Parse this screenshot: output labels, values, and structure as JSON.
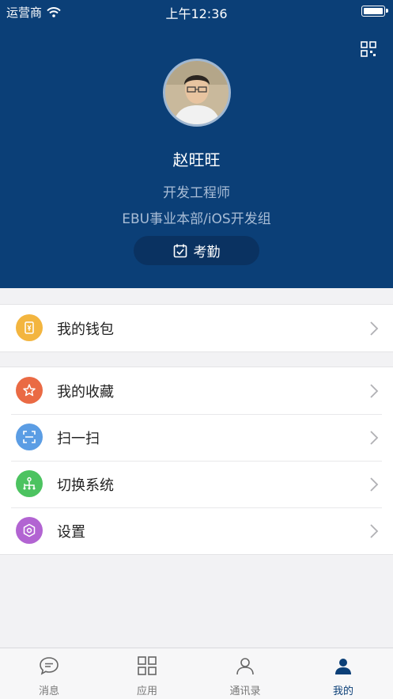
{
  "status_bar": {
    "carrier": "运营商",
    "time": "上午12:36"
  },
  "profile": {
    "name": "赵旺旺",
    "title": "开发工程师",
    "department": "EBU事业本部/iOS开发组",
    "attendance_label": "考勤"
  },
  "menu_groups": [
    [
      {
        "label": "我的钱包",
        "icon": "wallet-icon",
        "color": "#f3b53f"
      }
    ],
    [
      {
        "label": "我的收藏",
        "icon": "star-icon",
        "color": "#ea6a44"
      },
      {
        "label": "扫一扫",
        "icon": "scan-icon",
        "color": "#5b9de4"
      },
      {
        "label": "切换系统",
        "icon": "org-icon",
        "color": "#4cc360"
      },
      {
        "label": "设置",
        "icon": "gear-icon",
        "color": "#b264d2"
      }
    ]
  ],
  "tabs": [
    {
      "label": "消息",
      "icon": "message-icon"
    },
    {
      "label": "应用",
      "icon": "apps-icon"
    },
    {
      "label": "通讯录",
      "icon": "contacts-icon"
    },
    {
      "label": "我的",
      "icon": "me-icon"
    }
  ],
  "colors": {
    "header_bg": "#0b3f77",
    "attend_bg": "#0a3261",
    "active_tab": "#0b3f77"
  }
}
